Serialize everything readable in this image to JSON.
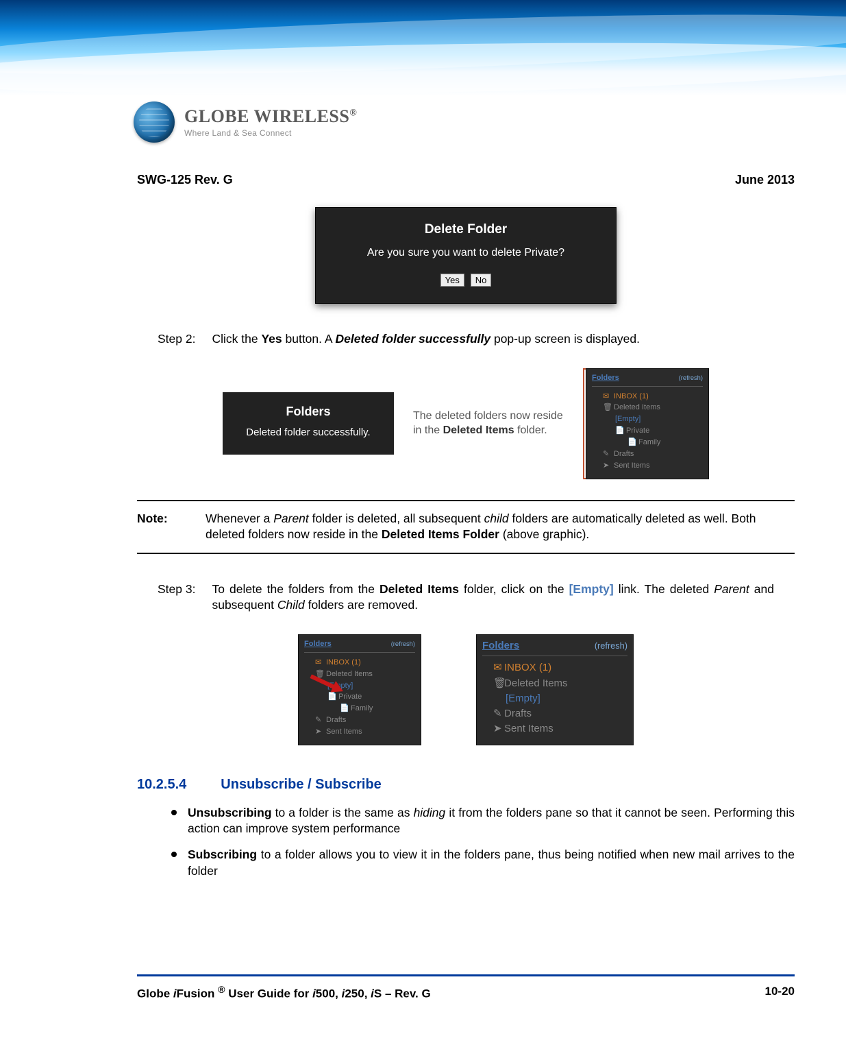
{
  "brand": {
    "name": "GLOBE WIRELESS",
    "reg": "®",
    "tagline": "Where Land & Sea Connect"
  },
  "header": {
    "left": "SWG-125 Rev. G",
    "right": "June 2013"
  },
  "dialog_delete": {
    "title": "Delete Folder",
    "message": "Are you sure you want to delete Private?",
    "yes": "Yes",
    "no": "No"
  },
  "step2": {
    "label": "Step  2:",
    "pre": "Click the ",
    "yes_b": "Yes",
    "mid": " button. A ",
    "result_bi": "Deleted folder successfully",
    "post": " pop-up screen is displayed."
  },
  "popup_success": {
    "title": "Folders",
    "msg": "Deleted folder successfully."
  },
  "callout": {
    "line1": "The deleted folders now reside in the ",
    "bold": "Deleted Items",
    "line2": " folder."
  },
  "folders_labels": {
    "title": "Folders",
    "refresh": "(refresh)",
    "inbox": "INBOX (1)",
    "deleted": "Deleted Items",
    "empty": "[Empty]",
    "private": "Private",
    "family": "Family",
    "drafts": "Drafts",
    "sent": "Sent Items"
  },
  "note": {
    "label": "Note:",
    "t1": "Whenever a ",
    "parent_i": "Parent",
    "t2": " folder is deleted, all subsequent ",
    "child_i": "child",
    "t3": " folders are automatically deleted as well. Both deleted folders now reside in the ",
    "dif_b": "Deleted Items Folder",
    "t4": " (above graphic)."
  },
  "step3": {
    "label": "Step  3:",
    "t1": "To delete the folders from the ",
    "di_b": "Deleted Items",
    "t2": " folder, click on the ",
    "empty_link": "[Empty]",
    "t3": " link. The deleted ",
    "parent_i": "Parent",
    "t4": " and subsequent ",
    "child_i": "Child",
    "t5": " folders are removed."
  },
  "section": {
    "num": "10.2.5.4",
    "title": "Unsubscribe / Subscribe"
  },
  "bullets": {
    "b1_strong": "Unsubscribing",
    "b1_t1": " to a folder is the same as ",
    "b1_i": "hiding",
    "b1_t2": " it from the folders pane so that it cannot be seen. Performing this action can improve system performance",
    "b2_strong": "Subscribing",
    "b2_t": " to a folder allows you to view it in the folders pane, thus being notified when new mail arrives to the folder"
  },
  "footer": {
    "left_pre": "Globe ",
    "left_i1": "i",
    "left_mid1": "Fusion ",
    "left_sup": "®",
    "left_mid2": " User Guide for ",
    "left_i2": "i",
    "left_s1": "500, ",
    "left_i3": "i",
    "left_s2": "250, ",
    "left_i4": "i",
    "left_s3": "S – Rev. G",
    "right": "10-20"
  }
}
